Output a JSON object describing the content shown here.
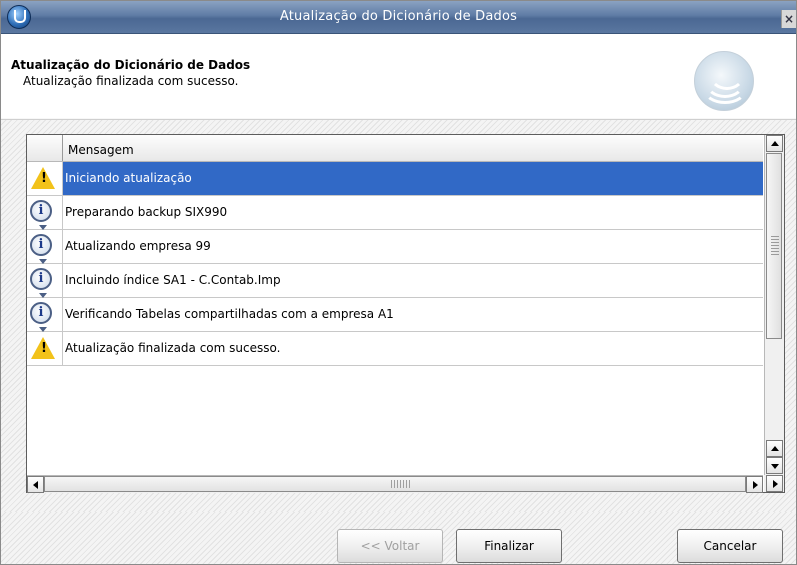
{
  "window": {
    "title": "Atualização do Dicionário de Dados",
    "close_label": "×"
  },
  "header": {
    "title": "Atualização do Dicionário de Dados",
    "subtitle": "Atualização finalizada com sucesso."
  },
  "grid": {
    "column_header": "Mensagem",
    "rows": [
      {
        "icon": "warning-icon",
        "text": "Iniciando atualização",
        "selected": true
      },
      {
        "icon": "info-icon",
        "text": "Preparando backup SIX990",
        "selected": false
      },
      {
        "icon": "info-icon",
        "text": "Atualizando empresa 99",
        "selected": false
      },
      {
        "icon": "info-icon",
        "text": "Incluindo índice SA1 - C.Contab.Imp",
        "selected": false
      },
      {
        "icon": "info-icon",
        "text": "Verificando Tabelas compartilhadas com a empresa A1",
        "selected": false
      },
      {
        "icon": "warning-icon",
        "text": "Atualização finalizada com sucesso.",
        "selected": false
      }
    ]
  },
  "buttons": {
    "back": "<< Voltar",
    "finish": "Finalizar",
    "cancel": "Cancelar"
  },
  "colors": {
    "selection": "#3169c6",
    "titlebar": "#5f7ca5",
    "warning": "#f2c21a"
  }
}
